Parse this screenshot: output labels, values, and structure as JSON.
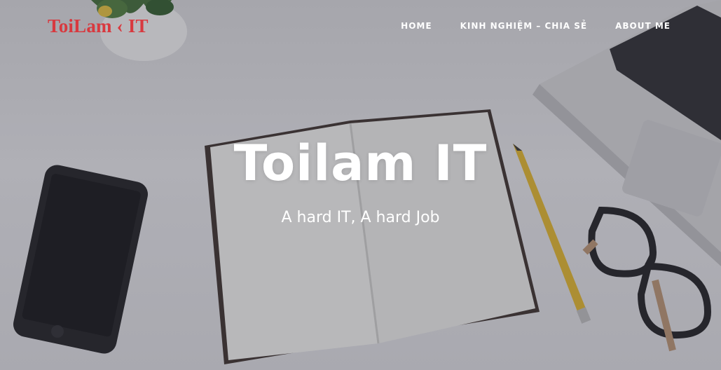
{
  "site": {
    "logo_text": "ToiLam ‹ IT",
    "title": "Toilam IT",
    "subtitle": "A hard IT, A hard Job"
  },
  "nav": {
    "items": [
      {
        "label": "HOME"
      },
      {
        "label": "KINH NGHIỆM – CHIA SẺ"
      },
      {
        "label": "ABOUT ME"
      }
    ]
  },
  "colors": {
    "logo": "#d8393f",
    "nav_text": "#ffffff",
    "hero_text": "#ffffff"
  }
}
